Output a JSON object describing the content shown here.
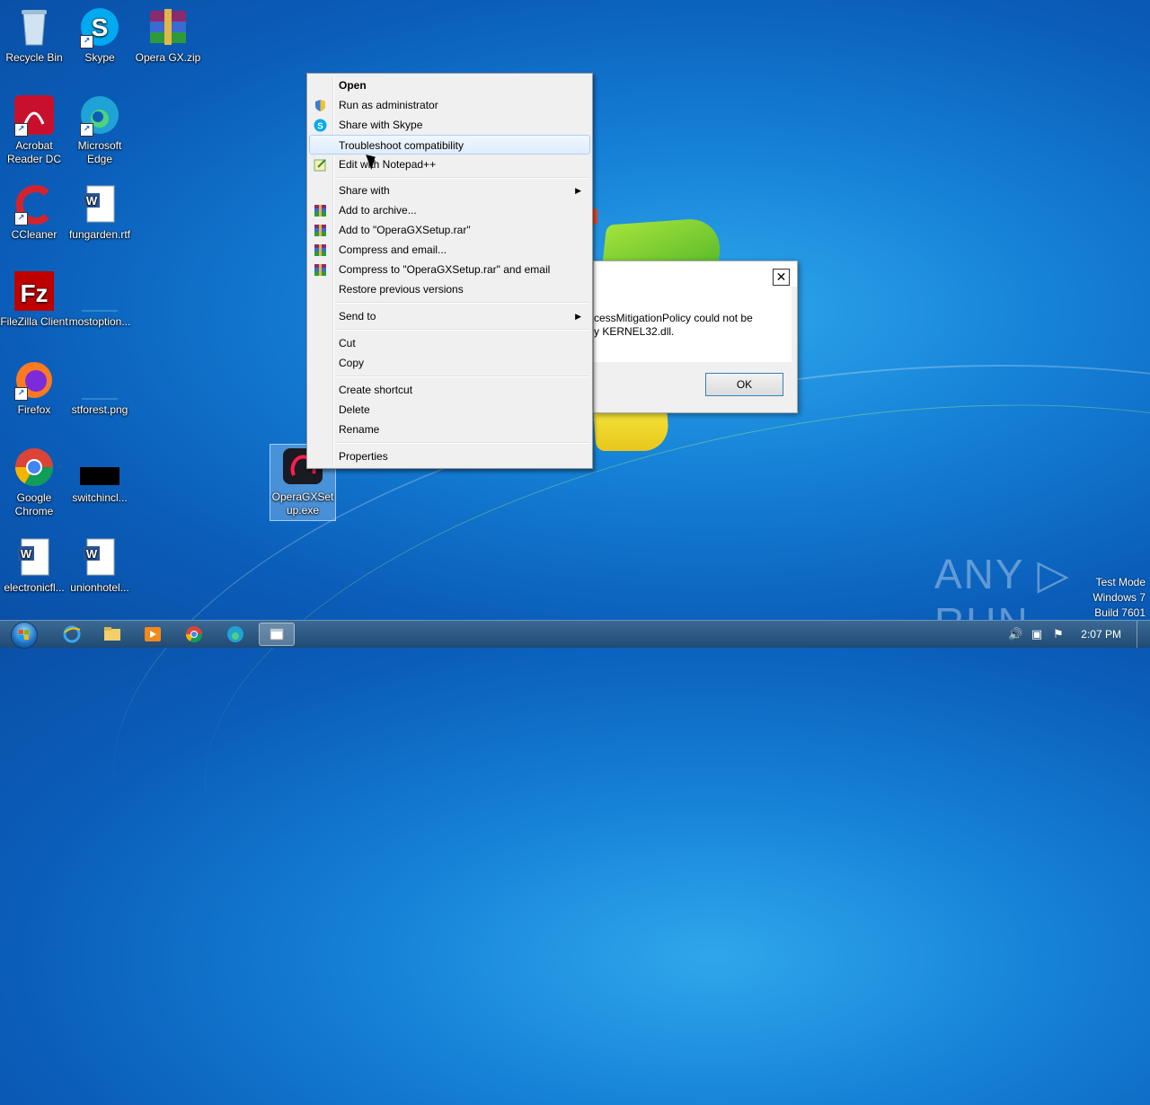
{
  "desktop": {
    "icons": [
      {
        "label": "Recycle Bin",
        "icon": "recycle-bin-icon"
      },
      {
        "label": "Skype",
        "icon": "skype-icon"
      },
      {
        "label": "Opera GX.zip",
        "icon": "winrar-archive-icon"
      },
      {
        "label": "Acrobat Reader DC",
        "icon": "acrobat-icon"
      },
      {
        "label": "Microsoft Edge",
        "icon": "edge-icon"
      },
      {
        "label": "CCleaner",
        "icon": "ccleaner-icon"
      },
      {
        "label": "fungarden.rtf",
        "icon": "word-document-icon"
      },
      {
        "label": "FileZilla Client",
        "icon": "filezilla-icon"
      },
      {
        "label": "mostoption...",
        "icon": "blank-file-icon"
      },
      {
        "label": "Firefox",
        "icon": "firefox-icon"
      },
      {
        "label": "stforest.png",
        "icon": "image-file-icon"
      },
      {
        "label": "Google Chrome",
        "icon": "chrome-icon"
      },
      {
        "label": "switchincl...",
        "icon": "black-image-icon"
      },
      {
        "label": "electronicfl...",
        "icon": "word-document-icon"
      },
      {
        "label": "unionhotel...",
        "icon": "word-document-icon"
      },
      {
        "label": "OperaGXSetup.exe",
        "icon": "opera-gx-icon"
      }
    ]
  },
  "context_menu": {
    "items": [
      {
        "label": "Open",
        "bold": true
      },
      {
        "label": "Run as administrator",
        "icon": "uac-shield-icon"
      },
      {
        "label": "Share with Skype",
        "icon": "skype-icon"
      },
      {
        "label": "Troubleshoot compatibility",
        "highlighted": true
      },
      {
        "label": "Edit with Notepad++",
        "icon": "notepadpp-icon"
      },
      {
        "label": "Share with",
        "submenu": true
      },
      {
        "label": "Add to archive...",
        "icon": "winrar-icon"
      },
      {
        "label": "Add to \"OperaGXSetup.rar\"",
        "icon": "winrar-icon"
      },
      {
        "label": "Compress and email...",
        "icon": "winrar-icon"
      },
      {
        "label": "Compress to \"OperaGXSetup.rar\" and email",
        "icon": "winrar-icon"
      },
      {
        "label": "Restore previous versions"
      },
      {
        "label": "Send to",
        "submenu": true
      },
      {
        "label": "Cut"
      },
      {
        "label": "Copy"
      },
      {
        "label": "Create shortcut"
      },
      {
        "label": "Delete"
      },
      {
        "label": "Rename"
      },
      {
        "label": "Properties"
      }
    ],
    "submenu_arrow": "▶"
  },
  "dialog": {
    "close_glyph": "✕",
    "message_line1": "cessMitigationPolicy could not be",
    "message_line2": "y KERNEL32.dll.",
    "ok_label": "OK"
  },
  "taskbar": {
    "clock": "2:07 PM"
  },
  "overlay": {
    "watermark": "ANY ▷ RUN",
    "test_mode_line1": "Test Mode",
    "test_mode_line2": "Windows 7",
    "test_mode_line3": "Build 7601"
  }
}
